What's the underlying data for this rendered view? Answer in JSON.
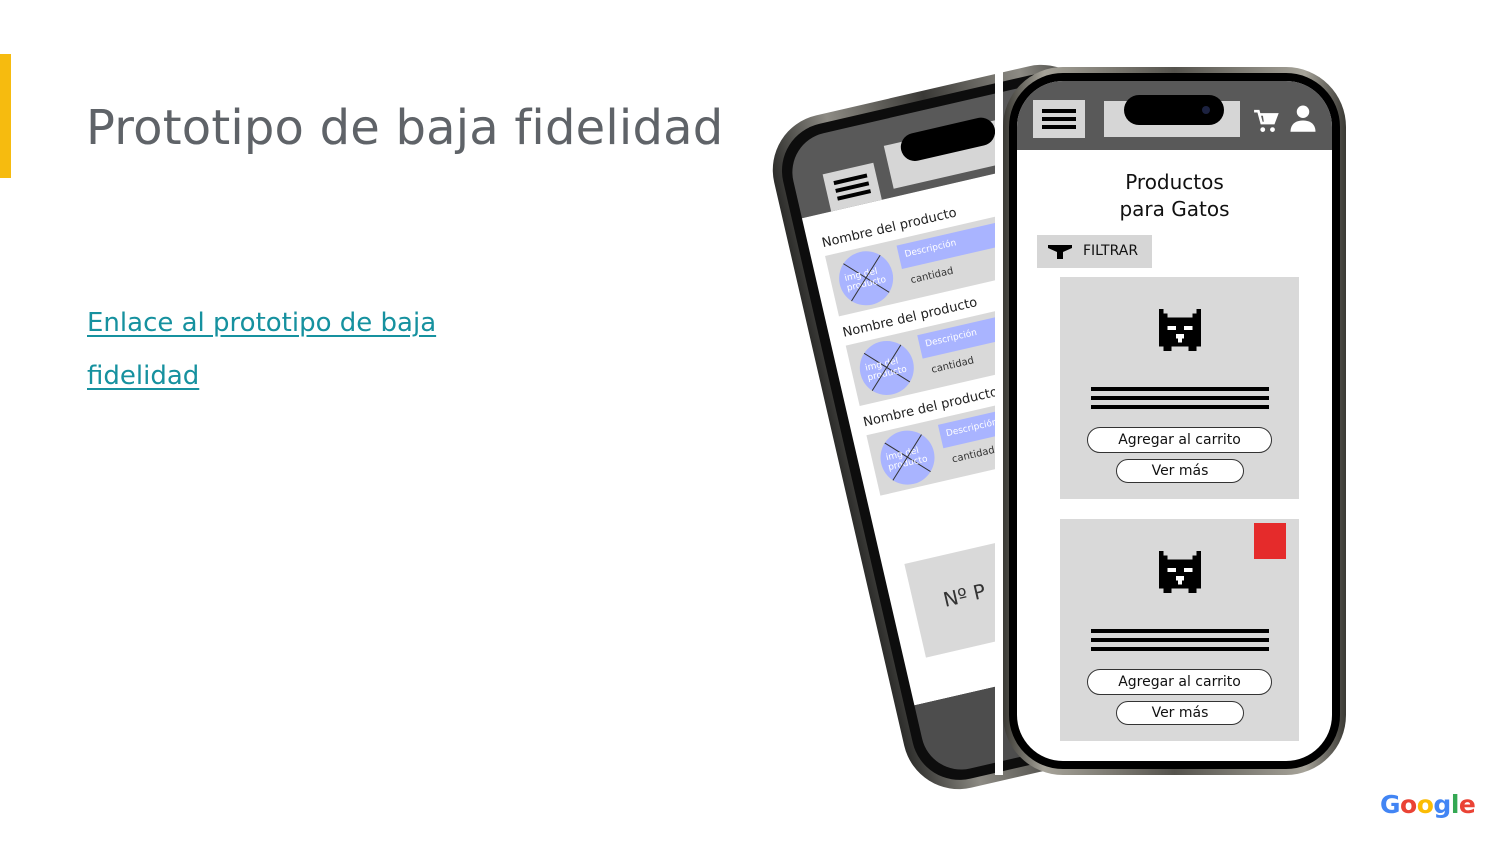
{
  "slide": {
    "title": "Prototipo de baja fidelidad",
    "link_text_line1": "Enlace al prototipo de baja",
    "link_text_line2": "fidelidad",
    "accent_color": "#f6bb0f",
    "link_color": "#16919f",
    "title_color": "#5f6368"
  },
  "back_phone": {
    "items": [
      {
        "name": "Nombre del producto",
        "image_label": "img del producto",
        "description": "Descripción",
        "quantity_label": "cantidad"
      },
      {
        "name": "Nombre del producto",
        "image_label": "img del producto",
        "description": "Descripción",
        "quantity_label": "cantidad"
      },
      {
        "name": "Nombre del producto",
        "image_label": "img del producto",
        "description": "Descripción",
        "quantity_label": "cantidad"
      }
    ],
    "total_label": "Nº P"
  },
  "front_phone": {
    "icons": [
      "hamburger-menu-icon",
      "cart-icon",
      "user-icon",
      "filter-funnel-icon",
      "cat-icon"
    ],
    "title_line1": "Productos",
    "title_line2": "para Gatos",
    "filter_label": "FILTRAR",
    "products": [
      {
        "add_label": "Agregar al carrito",
        "more_label": "Ver más",
        "badge": false
      },
      {
        "add_label": "Agregar al carrito",
        "more_label": "Ver más",
        "badge": true,
        "badge_color": "#e52b2b"
      }
    ]
  },
  "footer": {
    "logo_letters": [
      "G",
      "o",
      "o",
      "g",
      "l",
      "e"
    ],
    "logo_colors": [
      "#4285f4",
      "#ea4335",
      "#fbbc05",
      "#4285f4",
      "#34a853",
      "#ea4335"
    ]
  }
}
